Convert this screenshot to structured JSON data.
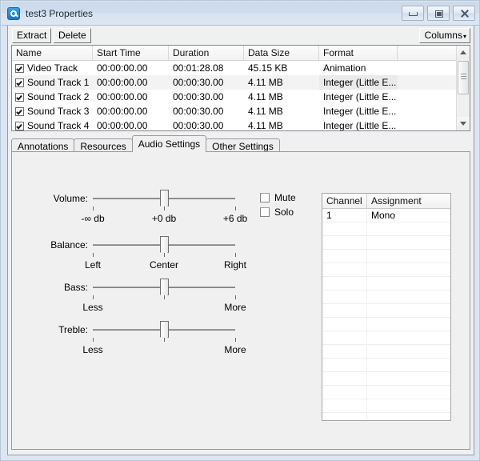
{
  "window": {
    "title": "test3 Properties",
    "app_icon": "app-logo-icon",
    "controls": {
      "minimize": "Minimize",
      "maximize": "Maximize",
      "close": "Close"
    }
  },
  "toolbar": {
    "extract_label": "Extract",
    "delete_label": "Delete",
    "columns_label": "Columns",
    "columns_caret": "▾"
  },
  "track_list": {
    "columns": [
      "Name",
      "Start Time",
      "Duration",
      "Data Size",
      "Format",
      ""
    ],
    "rows": [
      {
        "checked": true,
        "name": "Video Track",
        "start": "00:00:00.00",
        "duration": "00:01:28.08",
        "size": "45.15 KB",
        "format": "Animation"
      },
      {
        "checked": true,
        "name": "Sound Track 1",
        "start": "00:00:00.00",
        "duration": "00:00:30.00",
        "size": "4.11 MB",
        "format": "Integer (Little E..."
      },
      {
        "checked": true,
        "name": "Sound Track 2",
        "start": "00:00:00.00",
        "duration": "00:00:30.00",
        "size": "4.11 MB",
        "format": "Integer (Little E..."
      },
      {
        "checked": true,
        "name": "Sound Track 3",
        "start": "00:00:00.00",
        "duration": "00:00:30.00",
        "size": "4.11 MB",
        "format": "Integer (Little E..."
      },
      {
        "checked": true,
        "name": "Sound Track 4",
        "start": "00:00:00.00",
        "duration": "00:00:30.00",
        "size": "4.11 MB",
        "format": "Integer (Little E..."
      }
    ]
  },
  "tabs": [
    {
      "label": "Annotations",
      "active": false
    },
    {
      "label": "Resources",
      "active": false
    },
    {
      "label": "Audio Settings",
      "active": true
    },
    {
      "label": "Other Settings",
      "active": false
    }
  ],
  "audio_settings": {
    "sliders": [
      {
        "label": "Volume:",
        "value_percent": 50,
        "ticks": [
          "-∞ db",
          "+0 db",
          "+6 db"
        ]
      },
      {
        "label": "Balance:",
        "value_percent": 50,
        "ticks": [
          "Left",
          "Center",
          "Right"
        ]
      },
      {
        "label": "Bass:",
        "value_percent": 50,
        "ticks": [
          "Less",
          "",
          "More"
        ]
      },
      {
        "label": "Treble:",
        "value_percent": 50,
        "ticks": [
          "Less",
          "",
          "More"
        ]
      }
    ],
    "options": [
      {
        "label": "Mute",
        "checked": false
      },
      {
        "label": "Solo",
        "checked": false
      }
    ],
    "channel_table": {
      "columns": [
        "Channel",
        "Assignment"
      ],
      "rows": [
        {
          "channel": "1",
          "assignment": "Mono"
        }
      ],
      "empty_row_count": 15
    }
  },
  "colors": {
    "titlebar": "#cfdced",
    "window_frame": "#dce6f2",
    "panel": "#f0f0f0",
    "list_background": "#ffffff",
    "border": "#9a9a9a",
    "accent": "#1878c4"
  }
}
